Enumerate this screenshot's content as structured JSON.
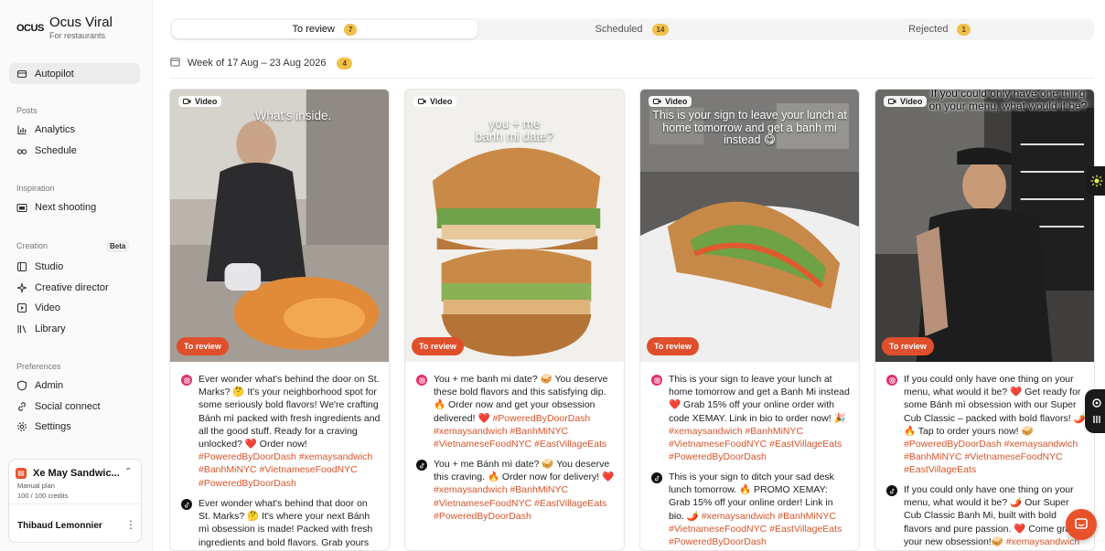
{
  "app": {
    "brand_mark": "OCUS",
    "name": "Ocus Viral",
    "subtitle": "For restaurants"
  },
  "sidebar": {
    "autopilot": "Autopilot",
    "sections": {
      "posts": "Posts",
      "inspiration": "Inspiration",
      "creation": "Creation",
      "preferences": "Preferences"
    },
    "creation_badge": "Beta",
    "items": {
      "analytics": "Analytics",
      "schedule": "Schedule",
      "next_shooting": "Next shooting",
      "studio": "Studio",
      "creative_director": "Creative director",
      "video": "Video",
      "library": "Library",
      "admin": "Admin",
      "social_connect": "Social connect",
      "settings": "Settings"
    },
    "workspace": {
      "name": "Xe May Sandwic...",
      "plan": "Manual plan",
      "credits": "100 / 100 credits",
      "user": "Thibaud Lemonnier"
    }
  },
  "tabs": [
    {
      "label": "To review",
      "count": "7"
    },
    {
      "label": "Scheduled",
      "count": "14"
    },
    {
      "label": "Rejected",
      "count": "1"
    }
  ],
  "week": {
    "label": "Week of 17 Aug – 23 Aug 2026",
    "count": "4"
  },
  "cards": [
    {
      "chip": "Video",
      "overlay": "What's inside.",
      "status": "To review",
      "posts": [
        {
          "platform": "instagram",
          "text": "Ever wonder what's behind the door on St. Marks? 🤔 It's your neighborhood spot for some seriously bold flavors! We're crafting Bánh mì packed with fresh ingredients and all the good stuff. Ready for a craving unlocked? ❤️ Order now!",
          "tags": "#PoweredByDoorDash #xemaysandwich #BanhMiNYC #VietnameseFoodNYC #PoweredByDoorDash"
        },
        {
          "platform": "tiktok",
          "text": "Ever wonder what's behind that door on St. Marks? 🤔 It's where your next Bánh mì obsession is made! Packed with fresh ingredients and bold flavors. Grab yours",
          "tags": ""
        }
      ]
    },
    {
      "chip": "Video",
      "overlay": "you + me\nbanh mi date?",
      "status": "To review",
      "posts": [
        {
          "platform": "instagram",
          "text": "You + me banh mi date? 🥪 You deserve these bold flavors and this satisfying dip. 🔥 Order now and get your obsession delivered! ❤️",
          "tags": "#PoweredByDoorDash #xemaysandwich #BanhMiNYC #VietnameseFoodNYC #EastVillageEats"
        },
        {
          "platform": "tiktok",
          "text": "You + me Bánh mì date? 🥪 You deserve this craving. 🔥 Order now for delivery! ❤️",
          "tags": "#xemaysandwich #BanhMiNYC #VietnameseFoodNYC #EastVillageEats #PoweredByDoorDash"
        }
      ]
    },
    {
      "chip": "Video",
      "overlay": "This is your sign to leave your lunch at home tomorrow and get a banh mi instead 😋",
      "status": "To review",
      "posts": [
        {
          "platform": "instagram",
          "text": "This is your sign to leave your lunch at home tomorrow and get a Banh Mi instead ❤️ Grab 15% off your online order with code XEMAY. Link in bio to order now! 🎉",
          "tags": "#xemaysandwich #BanhMiNYC #VietnameseFoodNYC #EastVillageEats #PoweredByDoorDash"
        },
        {
          "platform": "tiktok",
          "text": "This is your sign to ditch your sad desk lunch tomorrow. 🔥 PROMO XEMAY: Grab 15% off your online order! Link in bio. 🌶️",
          "tags": "#xemaysandwich #BanhMiNYC #VietnameseFoodNYC #EastVillageEats #PoweredByDoorDash"
        }
      ]
    },
    {
      "chip": "Video",
      "overlay": "If you could only have one thing on your menu, what would it be?",
      "status": "To review",
      "posts": [
        {
          "platform": "instagram",
          "text": "If you could only have one thing on your menu, what would it be? ❤️ Get ready for some Bánh mì obsession with our Super Cub Classic – packed with bold flavors! 🌶️ 🔥 Tap to order yours now! 🥪",
          "tags": "#PoweredByDoorDash #xemaysandwich #BanhMiNYC #VietnameseFoodNYC #EastVillageEats"
        },
        {
          "platform": "tiktok",
          "text": "If you could only have one thing on your menu, what would it be? 🌶️ Our Super Cub Classic Banh Mi, built with bold flavors and pure passion. ❤️ Come grab your new obsession!🥪",
          "tags": "#xemaysandwich"
        }
      ]
    }
  ],
  "colors": {
    "accent": "#e04f2c",
    "badge": "#f0c04a",
    "hashtag": "#d9542b"
  },
  "icons": [
    "autopilot-icon",
    "analytics-icon",
    "schedule-icon",
    "camera-icon",
    "studio-icon",
    "sparkle-icon",
    "video-icon",
    "library-icon",
    "shield-icon",
    "link-icon",
    "gear-icon",
    "calendar-icon",
    "instagram-icon",
    "tiktok-icon",
    "chat-icon"
  ]
}
